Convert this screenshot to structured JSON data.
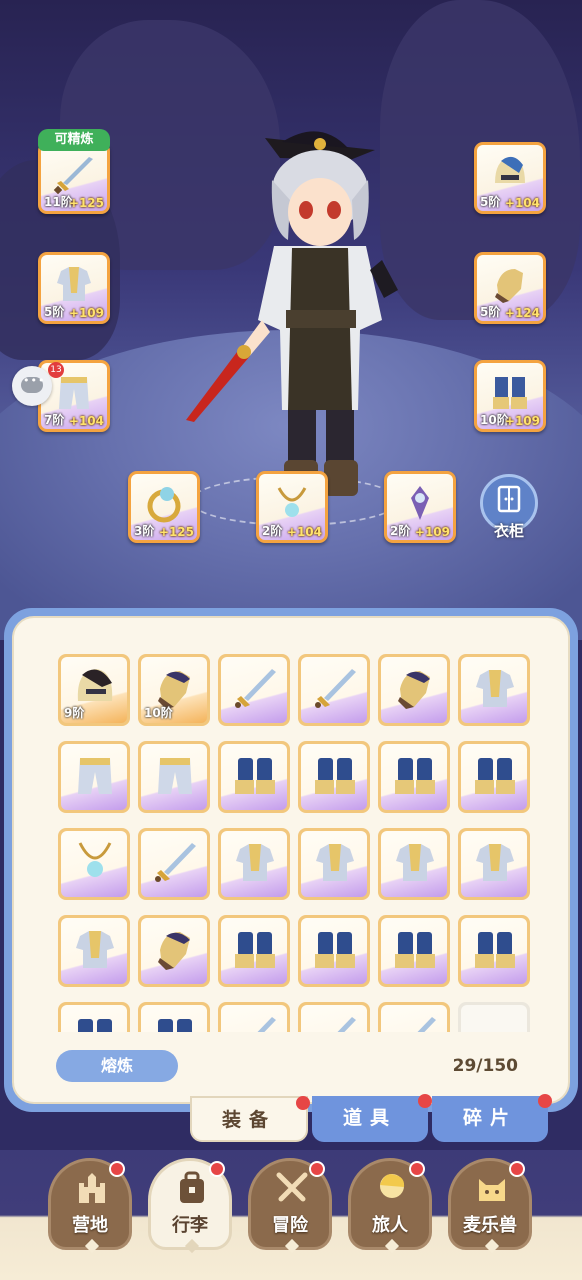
{
  "equipped_slots": [
    {
      "id": "weapon",
      "level": "11阶",
      "bonus": "+125",
      "icon": "sword-icon",
      "badge": "可精炼"
    },
    {
      "id": "helmet",
      "level": "5阶",
      "bonus": "+104",
      "icon": "helmet-icon"
    },
    {
      "id": "armor",
      "level": "5阶",
      "bonus": "+109",
      "icon": "armor-icon"
    },
    {
      "id": "gauntlet",
      "level": "5阶",
      "bonus": "+124",
      "icon": "gauntlet-icon"
    },
    {
      "id": "pants",
      "level": "7阶",
      "bonus": "+104",
      "icon": "pants-icon"
    },
    {
      "id": "boots",
      "level": "10阶",
      "bonus": "+109",
      "icon": "boots-icon"
    },
    {
      "id": "ring",
      "level": "3阶",
      "bonus": "+125",
      "icon": "ring-icon"
    },
    {
      "id": "necklace",
      "level": "2阶",
      "bonus": "+104",
      "icon": "necklace-icon"
    },
    {
      "id": "charm",
      "level": "2阶",
      "bonus": "+109",
      "icon": "charm-icon"
    }
  ],
  "chat": {
    "count": "13",
    "icon": "chat-bubble-icon"
  },
  "wardrobe": {
    "label": "衣柜",
    "icon": "wardrobe-icon"
  },
  "inventory": {
    "items": [
      {
        "icon": "helmet-icon",
        "level": "9阶",
        "rarity": "orange"
      },
      {
        "icon": "gauntlet-icon",
        "level": "10阶",
        "rarity": "orange"
      },
      {
        "icon": "sword-icon",
        "level": "",
        "rarity": "purple"
      },
      {
        "icon": "sword-icon",
        "level": "",
        "rarity": "purple"
      },
      {
        "icon": "gauntlet-icon",
        "level": "",
        "rarity": "purple"
      },
      {
        "icon": "armor-icon",
        "level": "",
        "rarity": "purple"
      },
      {
        "icon": "pants-icon",
        "level": "",
        "rarity": "purple"
      },
      {
        "icon": "pants-icon",
        "level": "",
        "rarity": "purple"
      },
      {
        "icon": "boots-icon",
        "level": "",
        "rarity": "purple"
      },
      {
        "icon": "boots-icon",
        "level": "",
        "rarity": "purple"
      },
      {
        "icon": "boots-icon",
        "level": "",
        "rarity": "purple"
      },
      {
        "icon": "boots-icon",
        "level": "",
        "rarity": "purple"
      },
      {
        "icon": "necklace-icon",
        "level": "",
        "rarity": "purple"
      },
      {
        "icon": "sword-icon",
        "level": "",
        "rarity": "purple"
      },
      {
        "icon": "armor-icon",
        "level": "",
        "rarity": "purple"
      },
      {
        "icon": "armor-icon",
        "level": "",
        "rarity": "purple"
      },
      {
        "icon": "armor-icon",
        "level": "",
        "rarity": "purple"
      },
      {
        "icon": "armor-icon",
        "level": "",
        "rarity": "purple"
      },
      {
        "icon": "armor-icon",
        "level": "",
        "rarity": "purple"
      },
      {
        "icon": "gauntlet-icon",
        "level": "",
        "rarity": "purple"
      },
      {
        "icon": "boots-icon",
        "level": "",
        "rarity": "purple"
      },
      {
        "icon": "boots-icon",
        "level": "",
        "rarity": "purple"
      },
      {
        "icon": "boots-icon",
        "level": "",
        "rarity": "purple"
      },
      {
        "icon": "boots-icon",
        "level": "",
        "rarity": "purple"
      },
      {
        "icon": "boots-icon",
        "level": "",
        "rarity": "purple"
      },
      {
        "icon": "boots-icon",
        "level": "",
        "rarity": "purple"
      },
      {
        "icon": "sword-icon",
        "level": "",
        "rarity": "purple"
      },
      {
        "icon": "sword-icon",
        "level": "",
        "rarity": "purple"
      },
      {
        "icon": "sword-icon",
        "level": "",
        "rarity": "purple"
      },
      {
        "icon": "",
        "level": "",
        "rarity": "empty"
      }
    ],
    "smelt_label": "熔炼",
    "capacity": "29/150"
  },
  "tabs": [
    {
      "label": "装备",
      "active": true
    },
    {
      "label": "道具",
      "active": false
    },
    {
      "label": "碎片",
      "active": false
    }
  ],
  "nav": [
    {
      "label": "营地",
      "icon": "castle-icon"
    },
    {
      "label": "行李",
      "icon": "backpack-icon",
      "active": true
    },
    {
      "label": "冒险",
      "icon": "crossed-swords-icon"
    },
    {
      "label": "旅人",
      "icon": "character-icon"
    },
    {
      "label": "麦乐兽",
      "icon": "cat-icon"
    }
  ]
}
